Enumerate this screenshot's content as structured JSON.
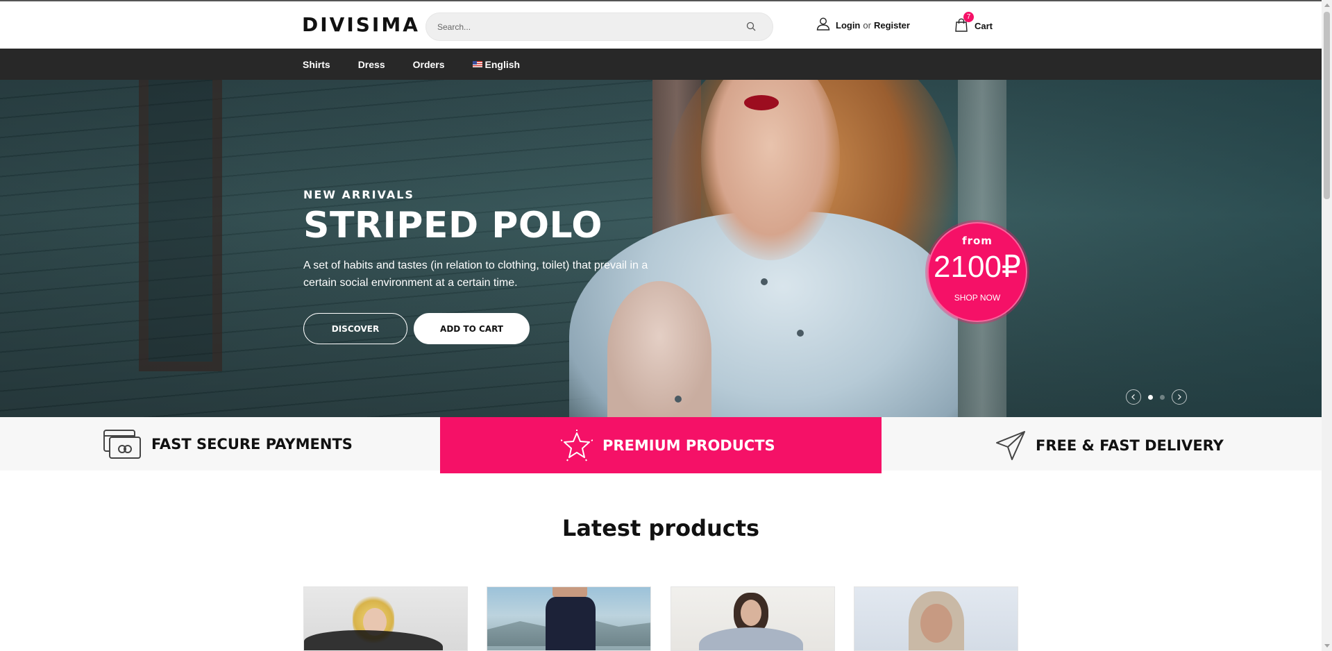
{
  "header": {
    "logo": "DIVISIMA",
    "search_placeholder": "Search...",
    "login_label": "Login",
    "or_label": "or",
    "register_label": "Register",
    "cart_label": "Cart",
    "cart_count": "7"
  },
  "nav": {
    "items": [
      {
        "label": "Shirts"
      },
      {
        "label": "Dress"
      },
      {
        "label": "Orders"
      },
      {
        "label": "English",
        "icon": "us-flag-icon"
      }
    ]
  },
  "hero": {
    "kicker": "NEW ARRIVALS",
    "title": "STRIPED POLO",
    "description": "A set of habits and tastes (in relation to clothing, toilet) that prevail in a certain social environment at a certain time.",
    "discover_label": "DISCOVER",
    "add_to_cart_label": "ADD TO CART",
    "price": {
      "from_label": "from",
      "amount": "2100₽",
      "shop_label": "SHOP NOW"
    },
    "slider": {
      "slide_count": 2,
      "active_slide": 1
    }
  },
  "features": [
    {
      "label": "FAST SECURE PAYMENTS",
      "icon": "credit-card-icon"
    },
    {
      "label": "PREMIUM PRODUCTS",
      "icon": "star-icon",
      "highlight_color": "#f51167"
    },
    {
      "label": "FREE & FAST DELIVERY",
      "icon": "paper-plane-icon"
    }
  ],
  "latest": {
    "title": "Latest products",
    "product_count": 4
  },
  "colors": {
    "accent": "#f51167",
    "nav_bg": "#282828",
    "features_bg": "#f7f7f7"
  }
}
